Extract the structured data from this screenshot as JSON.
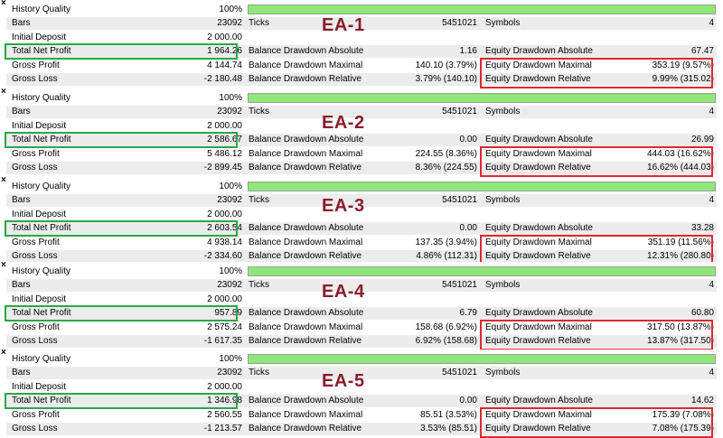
{
  "labels": {
    "history_quality": "History Quality",
    "bars": "Bars",
    "initial_deposit": "Initial Deposit",
    "total_net_profit": "Total Net Profit",
    "gross_profit": "Gross Profit",
    "gross_loss": "Gross Loss",
    "ticks": "Ticks",
    "symbols": "Symbols",
    "balance_dd_abs": "Balance Drawdown Absolute",
    "balance_dd_max": "Balance Drawdown Maximal",
    "balance_dd_rel": "Balance Drawdown Relative",
    "equity_dd_abs": "Equity Drawdown Absolute",
    "equity_dd_max": "Equity Drawdown Maximal",
    "equity_dd_rel": "Equity Drawdown Relative",
    "close_glyph": "×"
  },
  "colors": {
    "quality_bar": "#8ee878",
    "highlight_profit": "#29a84a",
    "highlight_equity": "#e0272f",
    "ea_label": "#8b1c2c"
  },
  "panels": [
    {
      "ea": "EA-1",
      "history_quality": "100%",
      "history_quality_fraction": 1.0,
      "bars": "23092",
      "initial_deposit": "2 000.00",
      "total_net_profit": "1 964.26",
      "gross_profit": "4 144.74",
      "gross_loss": "-2 180.48",
      "ticks": "5451021",
      "symbols": "4",
      "balance_dd_abs": "1.16",
      "balance_dd_max": "140.10 (3.79%)",
      "balance_dd_rel": "3.79% (140.10)",
      "equity_dd_abs": "67.47",
      "equity_dd_max": "353.19 (9.57%)",
      "equity_dd_rel": "9.99% (315.02)"
    },
    {
      "ea": "EA-2",
      "history_quality": "100%",
      "history_quality_fraction": 1.0,
      "bars": "23092",
      "initial_deposit": "2 000.00",
      "total_net_profit": "2 586.67",
      "gross_profit": "5 486.12",
      "gross_loss": "-2 899.45",
      "ticks": "5451021",
      "symbols": "4",
      "balance_dd_abs": "0.00",
      "balance_dd_max": "224.55 (8.36%)",
      "balance_dd_rel": "8.36% (224.55)",
      "equity_dd_abs": "26.99",
      "equity_dd_max": "444.03 (16.62%)",
      "equity_dd_rel": "16.62% (444.03)"
    },
    {
      "ea": "EA-3",
      "history_quality": "100%",
      "history_quality_fraction": 1.0,
      "bars": "23092",
      "initial_deposit": "2 000.00",
      "total_net_profit": "2 603.54",
      "gross_profit": "4 938.14",
      "gross_loss": "-2 334.60",
      "ticks": "5451021",
      "symbols": "4",
      "balance_dd_abs": "0.00",
      "balance_dd_max": "137.35 (3.94%)",
      "balance_dd_rel": "4.86% (112.31)",
      "equity_dd_abs": "33.28",
      "equity_dd_max": "351.19 (11.56%)",
      "equity_dd_rel": "12.31% (280.80)"
    },
    {
      "ea": "EA-4",
      "history_quality": "100%",
      "history_quality_fraction": 1.0,
      "bars": "23092",
      "initial_deposit": "2 000.00",
      "total_net_profit": "957.89",
      "gross_profit": "2 575.24",
      "gross_loss": "-1 617.35",
      "ticks": "5451021",
      "symbols": "4",
      "balance_dd_abs": "6.79",
      "balance_dd_max": "158.68 (6.92%)",
      "balance_dd_rel": "6.92% (158.68)",
      "equity_dd_abs": "60.80",
      "equity_dd_max": "317.50 (13.87%)",
      "equity_dd_rel": "13.87% (317.50)"
    },
    {
      "ea": "EA-5",
      "history_quality": "100%",
      "history_quality_fraction": 1.0,
      "bars": "23092",
      "initial_deposit": "2 000.00",
      "total_net_profit": "1 346.98",
      "gross_profit": "2 560.55",
      "gross_loss": "-1 213.57",
      "ticks": "5451021",
      "symbols": "4",
      "balance_dd_abs": "0.00",
      "balance_dd_max": "85.51 (3.53%)",
      "balance_dd_rel": "3.53% (85.51)",
      "equity_dd_abs": "14.62",
      "equity_dd_max": "175.39 (7.08%)",
      "equity_dd_rel": "7.08% (175.39)"
    }
  ]
}
